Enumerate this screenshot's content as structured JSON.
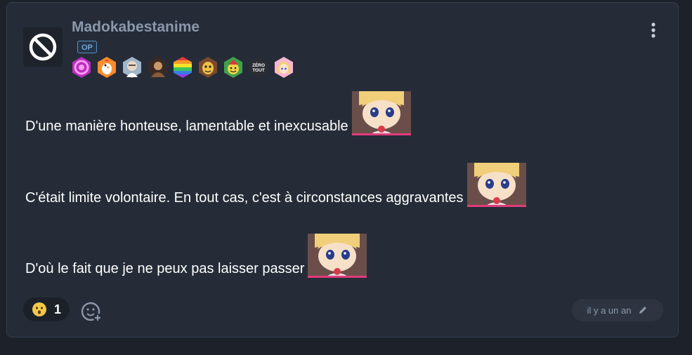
{
  "post": {
    "author": {
      "name": "Madokabestanime",
      "op_label": "OP",
      "avatar_icon": "blocked-icon"
    },
    "badges": [
      {
        "name": "pink-spiral-badge",
        "colors": [
          "#d63cd8",
          "#ff9cf0"
        ]
      },
      {
        "name": "chicken-badge",
        "colors": [
          "#ff8a2b",
          "#ffffff"
        ]
      },
      {
        "name": "old-man-badge",
        "colors": [
          "#9fb6cc",
          "#e9d7c2"
        ]
      },
      {
        "name": "dark-portrait-badge",
        "colors": [
          "#3a2a24",
          "#c89a6a"
        ]
      },
      {
        "name": "rainbow-badge",
        "colors": [
          "#e63b3b",
          "#f39a2b",
          "#f3e12b",
          "#3bc45a",
          "#3b7be6",
          "#9a3be6"
        ]
      },
      {
        "name": "cartoon-character-badge",
        "colors": [
          "#7a4a2c",
          "#f0c04a"
        ]
      },
      {
        "name": "christmas-smiley-badge",
        "colors": [
          "#3fa34a",
          "#f3d24a",
          "#d63a3a"
        ]
      },
      {
        "name": "zero-tout-badge",
        "colors": [
          "#2a2d33",
          "#ffffff"
        ],
        "text": "ZÉRO TOUT"
      },
      {
        "name": "anime-girl-badge",
        "colors": [
          "#f7b8d0",
          "#f3d36a"
        ]
      }
    ],
    "paragraphs": [
      {
        "text": "D'une manière honteuse, lamentable et inexcusable",
        "sticker": "anime-plush-sticker"
      },
      {
        "text": "C'était limite volontaire. En tout cas, c'est à circonstances aggravantes",
        "sticker": "anime-plush-sticker"
      },
      {
        "text": "D'où le fait que je ne peux pas laisser passer",
        "sticker": "anime-plush-sticker"
      }
    ],
    "reaction": {
      "emoji": "hushed-face-icon",
      "count": "1"
    },
    "add_reaction_icon": "add-reaction-icon",
    "timestamp": "il y a un an",
    "edit_icon": "pencil-icon"
  },
  "colors": {
    "page_bg": "#1c212a",
    "card_bg": "#252c38",
    "username": "#8b98ab",
    "op_accent": "#5a8fc4"
  }
}
